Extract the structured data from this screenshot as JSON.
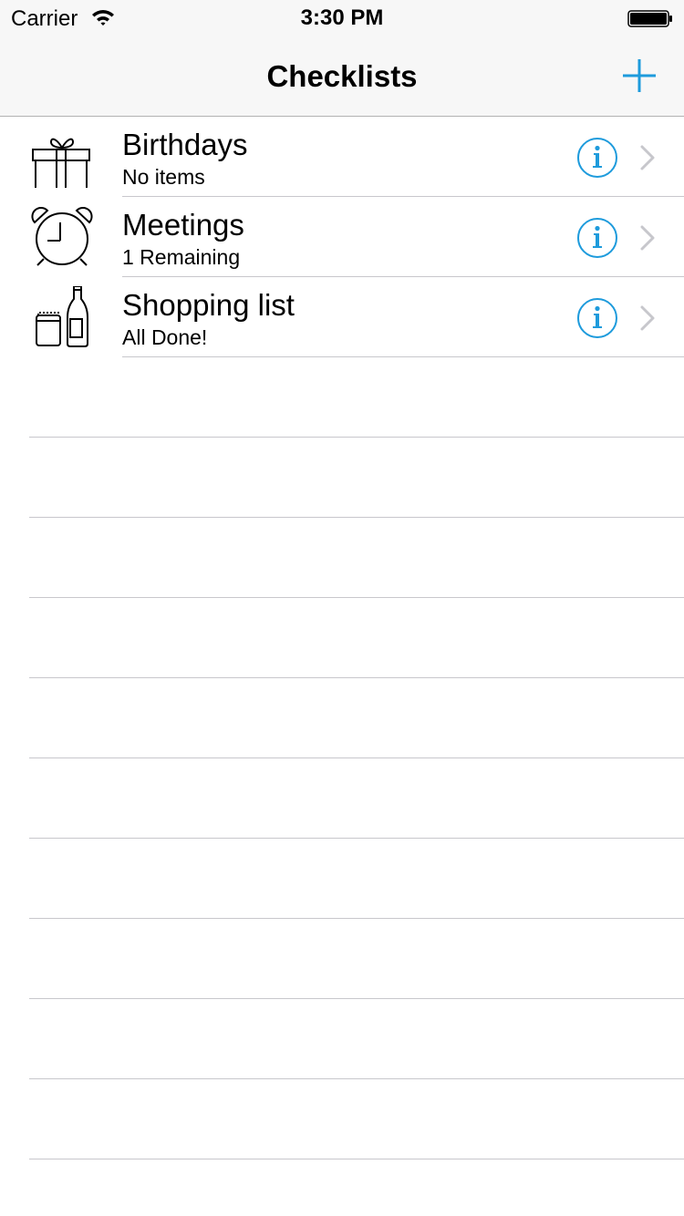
{
  "status_bar": {
    "carrier": "Carrier",
    "time": "3:30 PM",
    "wifi_icon": "wifi-icon",
    "battery_icon": "battery-icon"
  },
  "nav": {
    "title": "Checklists",
    "add_icon": "plus-icon",
    "accent_color": "#1e9bdc"
  },
  "checklists": [
    {
      "title": "Birthdays",
      "subtitle": "No items",
      "icon": "gift-icon"
    },
    {
      "title": "Meetings",
      "subtitle": "1 Remaining",
      "icon": "alarm-clock-icon"
    },
    {
      "title": "Shopping list",
      "subtitle": "All Done!",
      "icon": "groceries-icon"
    }
  ]
}
